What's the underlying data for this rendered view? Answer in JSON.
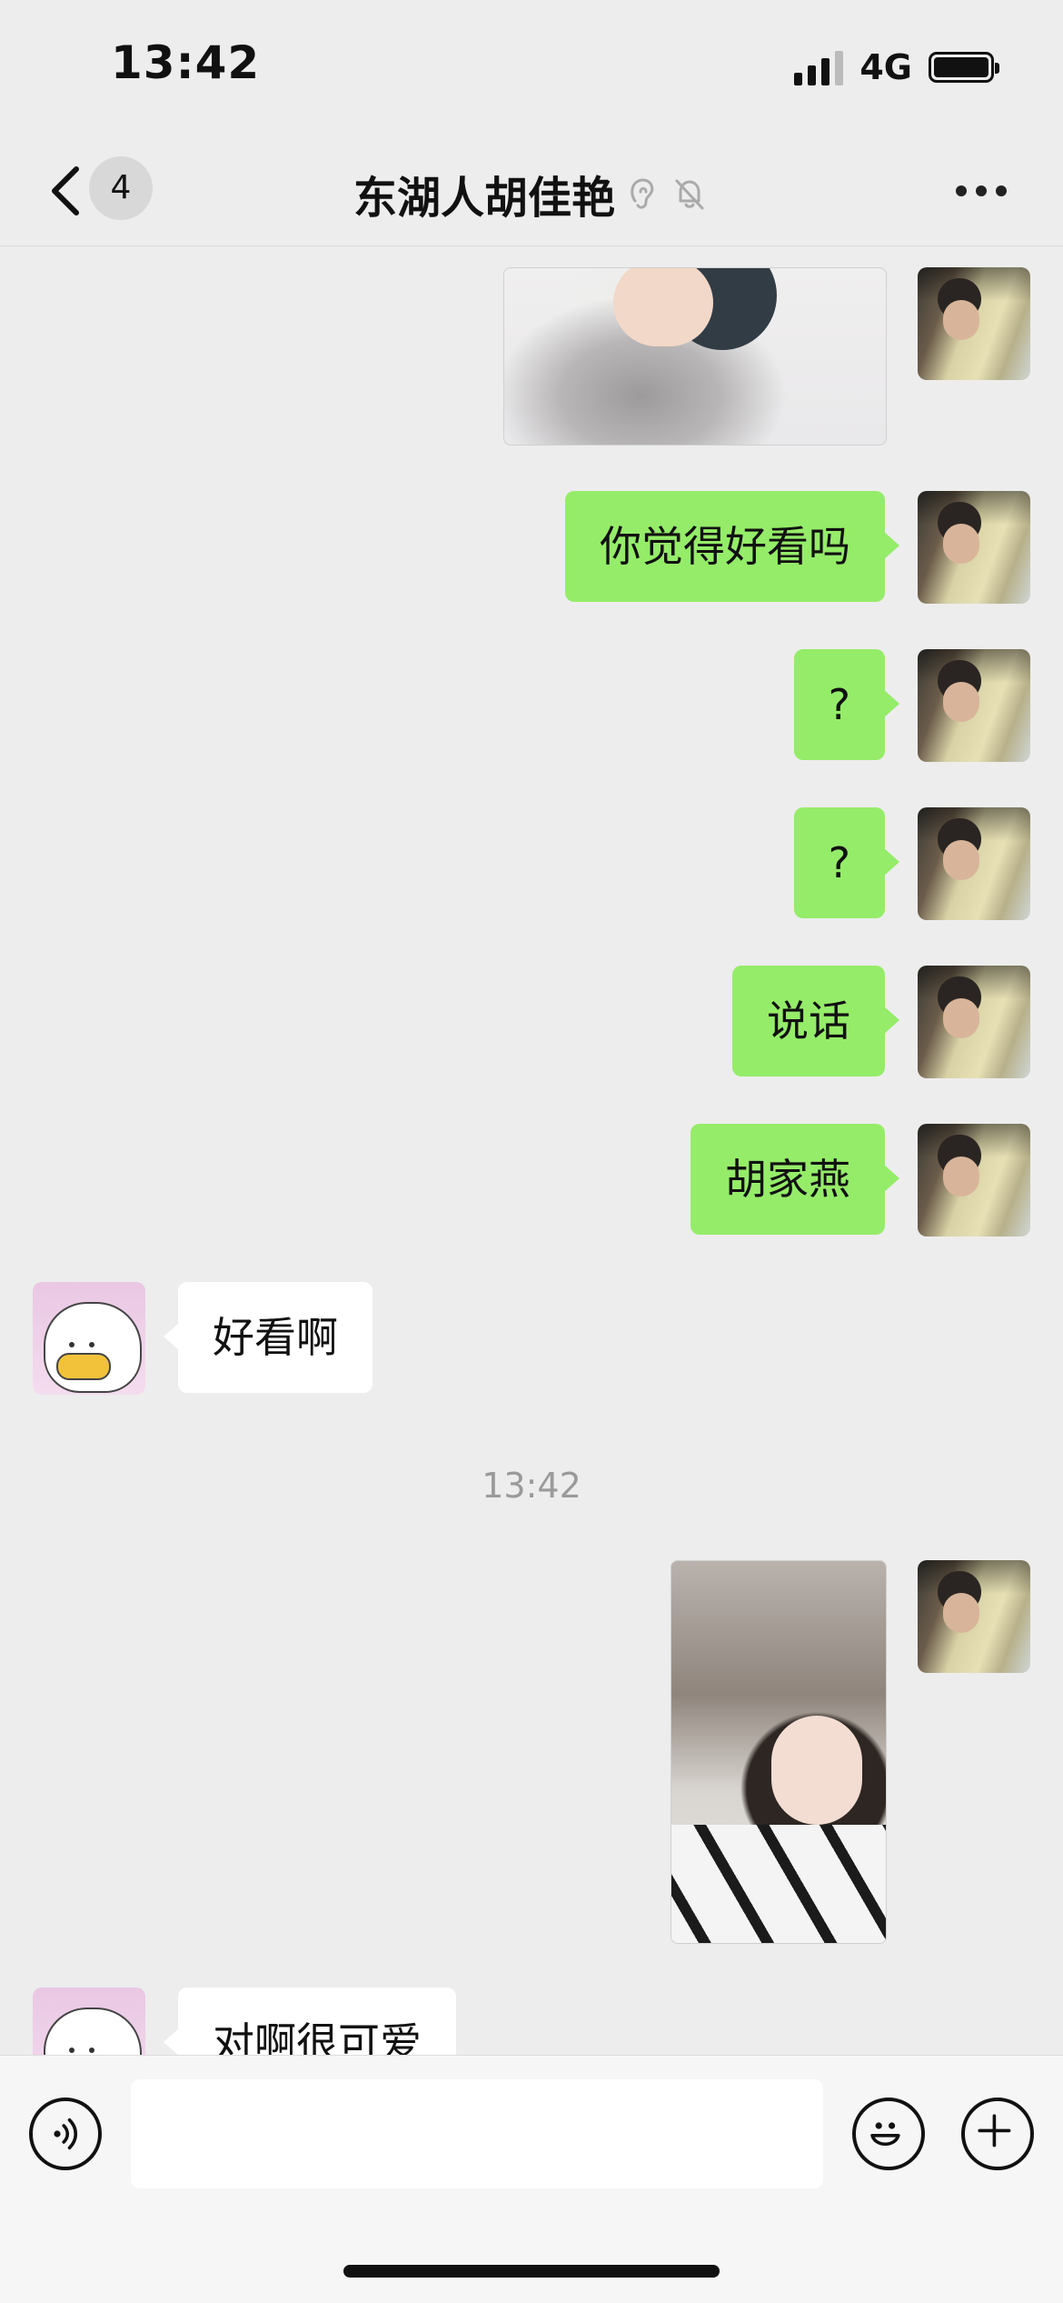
{
  "status_bar": {
    "time": "13:42",
    "network": "4G"
  },
  "nav": {
    "unread_count": "4",
    "title": "东湖人胡佳艳"
  },
  "messages": {
    "m1": "你觉得好看吗",
    "m2": "?",
    "m3": "?",
    "m4": "说话",
    "m5": "胡家燕",
    "m6": "好看啊",
    "timestamp": "13:42",
    "m7": "对啊很可爱"
  },
  "icons": {
    "back": "chevron-left-icon",
    "ear": "ear-icon",
    "mute": "bell-slash-icon",
    "more": "more-horizontal-icon",
    "voice": "voice-icon",
    "emoji": "emoji-icon",
    "plus": "plus-icon"
  },
  "colors": {
    "background": "#ededed",
    "bubble_me": "#95ec69",
    "bubble_other": "#ffffff",
    "timestamp": "#9a9a9a"
  }
}
